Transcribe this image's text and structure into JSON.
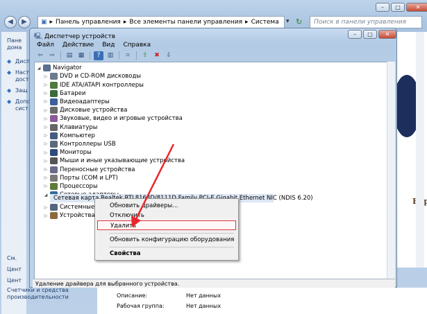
{
  "outer": {
    "address_parts": [
      "Панель управления",
      "Все элементы панели управления",
      "Система"
    ],
    "search_placeholder": "Поиск в панели управления",
    "help_icon": "?",
    "left_links": [
      "Пане домa",
      "Дисп",
      "Наст дост",
      "Защ",
      "Допо сист"
    ],
    "left_footer": [
      "См.",
      "Цент",
      "Цент"
    ],
    "left_footer_perf": "Счетчики и средства производительности",
    "info": [
      {
        "label": "Описание:",
        "value": "Нет данных"
      },
      {
        "label": "Рабочая группа:",
        "value": "Нет данных"
      }
    ],
    "right_text": "Вар"
  },
  "device_manager": {
    "title": "Диспетчер устройств",
    "menu": [
      "Файл",
      "Действие",
      "Вид",
      "Справка"
    ],
    "toolbar_icons": [
      "back-icon",
      "forward-icon",
      "properties-icon",
      "update-icon",
      "help-icon",
      "tree-icon",
      "scan-icon",
      "enable-icon",
      "disable-icon",
      "uninstall-icon"
    ],
    "root": "Navigator",
    "categories": [
      "DVD и CD-ROM дисководы",
      "IDE ATA/ATAPI контроллеры",
      "Батареи",
      "Видеоадаптеры",
      "Дисковые устройства",
      "Звуковые, видео и игровые устройства",
      "Клавиатуры",
      "Компьютер",
      "Контроллеры USB",
      "Мониторы",
      "Мыши и иные указывающие устройства",
      "Переносные устройства",
      "Порты (COM и LPT)",
      "Процессоры",
      "Сетевые адаптеры"
    ],
    "selected_device": "Сетевая карта Realtek RTL8168D/8111D Family PCI-E Gigabit Ethernet NIC (NDIS 6.20)",
    "after_categories": [
      "Системные устройства",
      "Устройства HID"
    ],
    "status": "Удаление драйвера для выбранного устройства."
  },
  "context_menu": {
    "items": [
      "Обновить драйверы...",
      "Отключить",
      "Удалить",
      "Обновить конфигурацию оборудования",
      "Свойства"
    ],
    "highlighted": "Удалить"
  },
  "colors": {
    "annotation_arrow": "#e8262c",
    "highlight_border": "#e0343e"
  }
}
